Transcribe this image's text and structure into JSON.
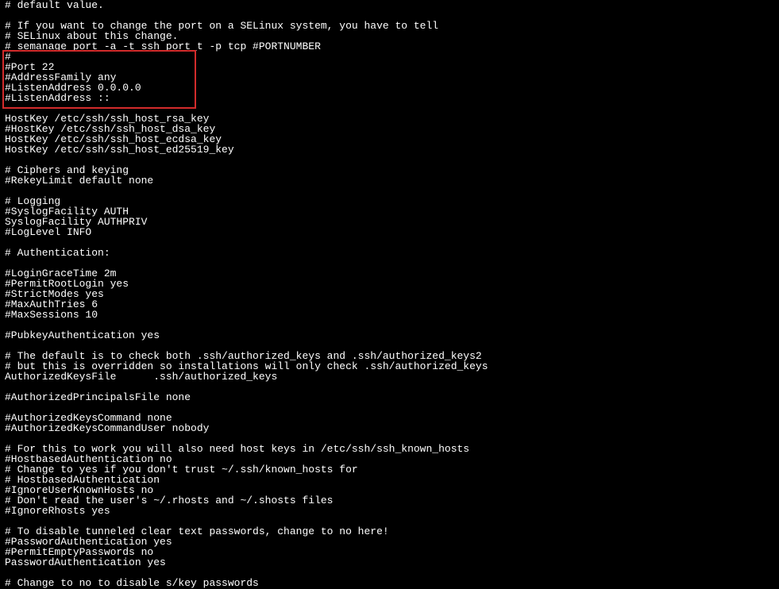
{
  "highlight": {
    "color": "#d22b2b",
    "covers_lines": "6-10"
  },
  "lines": [
    "# default value.",
    "",
    "# If you want to change the port on a SELinux system, you have to tell",
    "# SELinux about this change.",
    "# semanage port -a -t ssh_port_t -p tcp #PORTNUMBER",
    "#",
    "#Port 22",
    "#AddressFamily any",
    "#ListenAddress 0.0.0.0",
    "#ListenAddress ::",
    "",
    "HostKey /etc/ssh/ssh_host_rsa_key",
    "#HostKey /etc/ssh/ssh_host_dsa_key",
    "HostKey /etc/ssh/ssh_host_ecdsa_key",
    "HostKey /etc/ssh/ssh_host_ed25519_key",
    "",
    "# Ciphers and keying",
    "#RekeyLimit default none",
    "",
    "# Logging",
    "#SyslogFacility AUTH",
    "SyslogFacility AUTHPRIV",
    "#LogLevel INFO",
    "",
    "# Authentication:",
    "",
    "#LoginGraceTime 2m",
    "#PermitRootLogin yes",
    "#StrictModes yes",
    "#MaxAuthTries 6",
    "#MaxSessions 10",
    "",
    "#PubkeyAuthentication yes",
    "",
    "# The default is to check both .ssh/authorized_keys and .ssh/authorized_keys2",
    "# but this is overridden so installations will only check .ssh/authorized_keys",
    "AuthorizedKeysFile      .ssh/authorized_keys",
    "",
    "#AuthorizedPrincipalsFile none",
    "",
    "#AuthorizedKeysCommand none",
    "#AuthorizedKeysCommandUser nobody",
    "",
    "# For this to work you will also need host keys in /etc/ssh/ssh_known_hosts",
    "#HostbasedAuthentication no",
    "# Change to yes if you don't trust ~/.ssh/known_hosts for",
    "# HostbasedAuthentication",
    "#IgnoreUserKnownHosts no",
    "# Don't read the user's ~/.rhosts and ~/.shosts files",
    "#IgnoreRhosts yes",
    "",
    "# To disable tunneled clear text passwords, change to no here!",
    "#PasswordAuthentication yes",
    "#PermitEmptyPasswords no",
    "PasswordAuthentication yes",
    "",
    "# Change to no to disable s/key passwords"
  ]
}
